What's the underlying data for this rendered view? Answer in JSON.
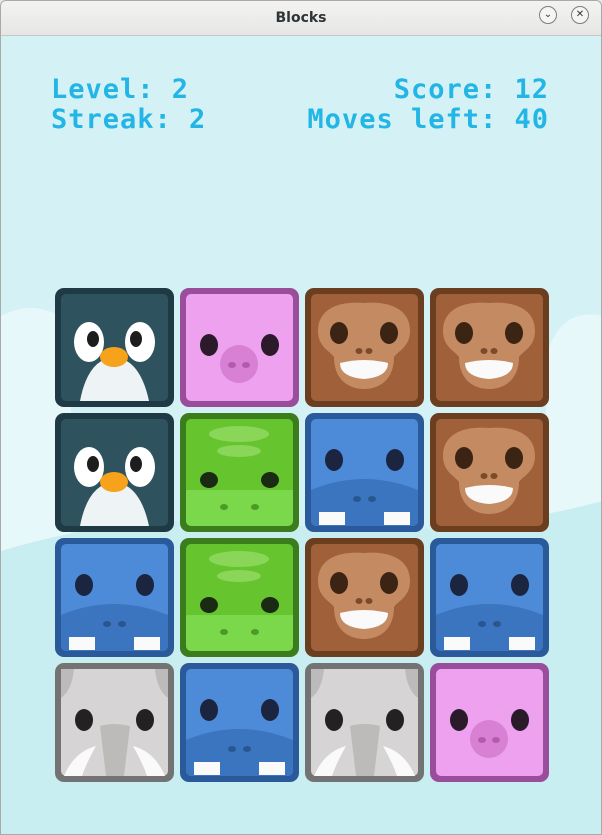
{
  "window": {
    "title": "Blocks"
  },
  "hud": {
    "level_text": "Level: 2",
    "streak_text": "Streak: 2",
    "score_text": "Score: 12",
    "moves_text": "Moves left: 40"
  },
  "colors": {
    "hud_text": "#22b5e5",
    "background": "#d4f2f5"
  },
  "board": {
    "rows": [
      [
        "penguin",
        "pig",
        "monkey",
        "monkey"
      ],
      [
        "penguin",
        "crocodile",
        "hippo",
        "monkey"
      ],
      [
        "hippo",
        "crocodile",
        "monkey",
        "hippo"
      ],
      [
        "elephant",
        "hippo",
        "elephant",
        "pig"
      ]
    ]
  }
}
